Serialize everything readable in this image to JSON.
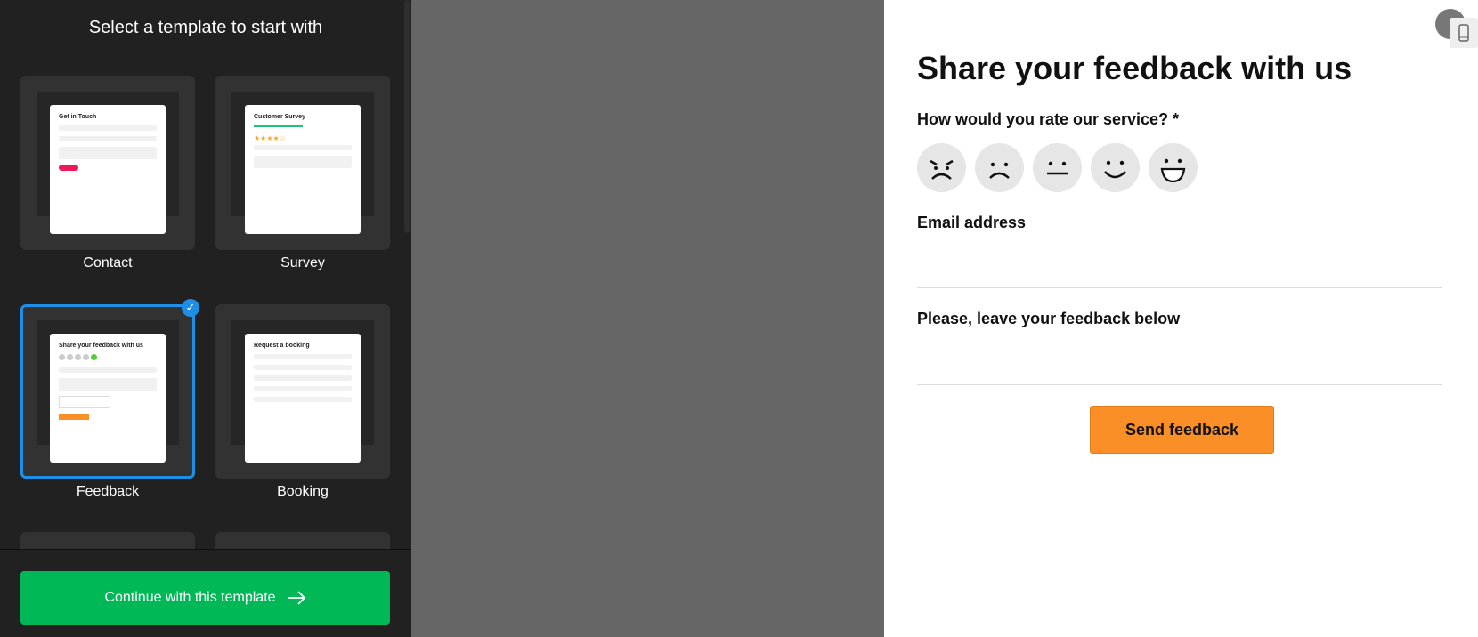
{
  "sidebar": {
    "title": "Select a template to start with",
    "templates": [
      {
        "label": "Contact",
        "preview_title": "Get in Touch"
      },
      {
        "label": "Survey",
        "preview_title": "Customer Survey"
      },
      {
        "label": "Feedback",
        "preview_title": "Share your feedback with us",
        "selected": true
      },
      {
        "label": "Booking",
        "preview_title": "Request a booking"
      }
    ],
    "continue_label": "Continue with this template",
    "continue_icon": "arrow-right-icon"
  },
  "form": {
    "title": "Share your feedback with us",
    "rating_label": "How would you rate our service? *",
    "rating_icons": [
      "angry-face-icon",
      "sad-face-icon",
      "neutral-face-icon",
      "smile-face-icon",
      "grin-face-icon"
    ],
    "email_label": "Email address",
    "feedback_label": "Please, leave your feedback below",
    "submit_label": "Send feedback"
  },
  "colors": {
    "accent": "#1d8fe6",
    "continue": "#00b956",
    "submit": "#f98f26"
  }
}
